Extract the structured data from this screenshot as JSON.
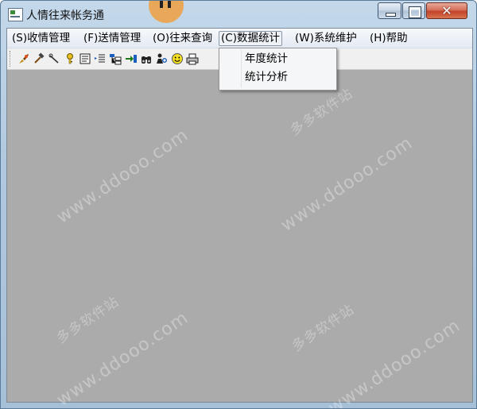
{
  "window": {
    "title": "人情往来帐务通",
    "close_glyph": "✕"
  },
  "menubar": {
    "items": [
      {
        "label": "(S)收情管理"
      },
      {
        "label": "(F)送情管理"
      },
      {
        "label": "(O)往来查询"
      },
      {
        "label": "(C)数据统计"
      },
      {
        "label": "(W)系统维护"
      },
      {
        "label": "(H)帮助"
      }
    ],
    "active_index": 3
  },
  "dropdown": {
    "items": [
      {
        "label": "年度统计"
      },
      {
        "label": "统计分析"
      }
    ]
  },
  "toolbar": {
    "icons": [
      "brush-icon",
      "hammer-icon",
      "wand-icon",
      "key-icon",
      "document-icon",
      "indent-icon",
      "tree-icon",
      "export-icon",
      "binoculars-icon",
      "user-search-icon",
      "smiley-icon",
      "printer-icon"
    ]
  },
  "watermark": {
    "url": "www.ddooo.com",
    "cn": "多多软件站"
  },
  "colors": {
    "client_bg": "#ababab",
    "frame": "#b1c9e0",
    "close_button": "#c2432a"
  }
}
